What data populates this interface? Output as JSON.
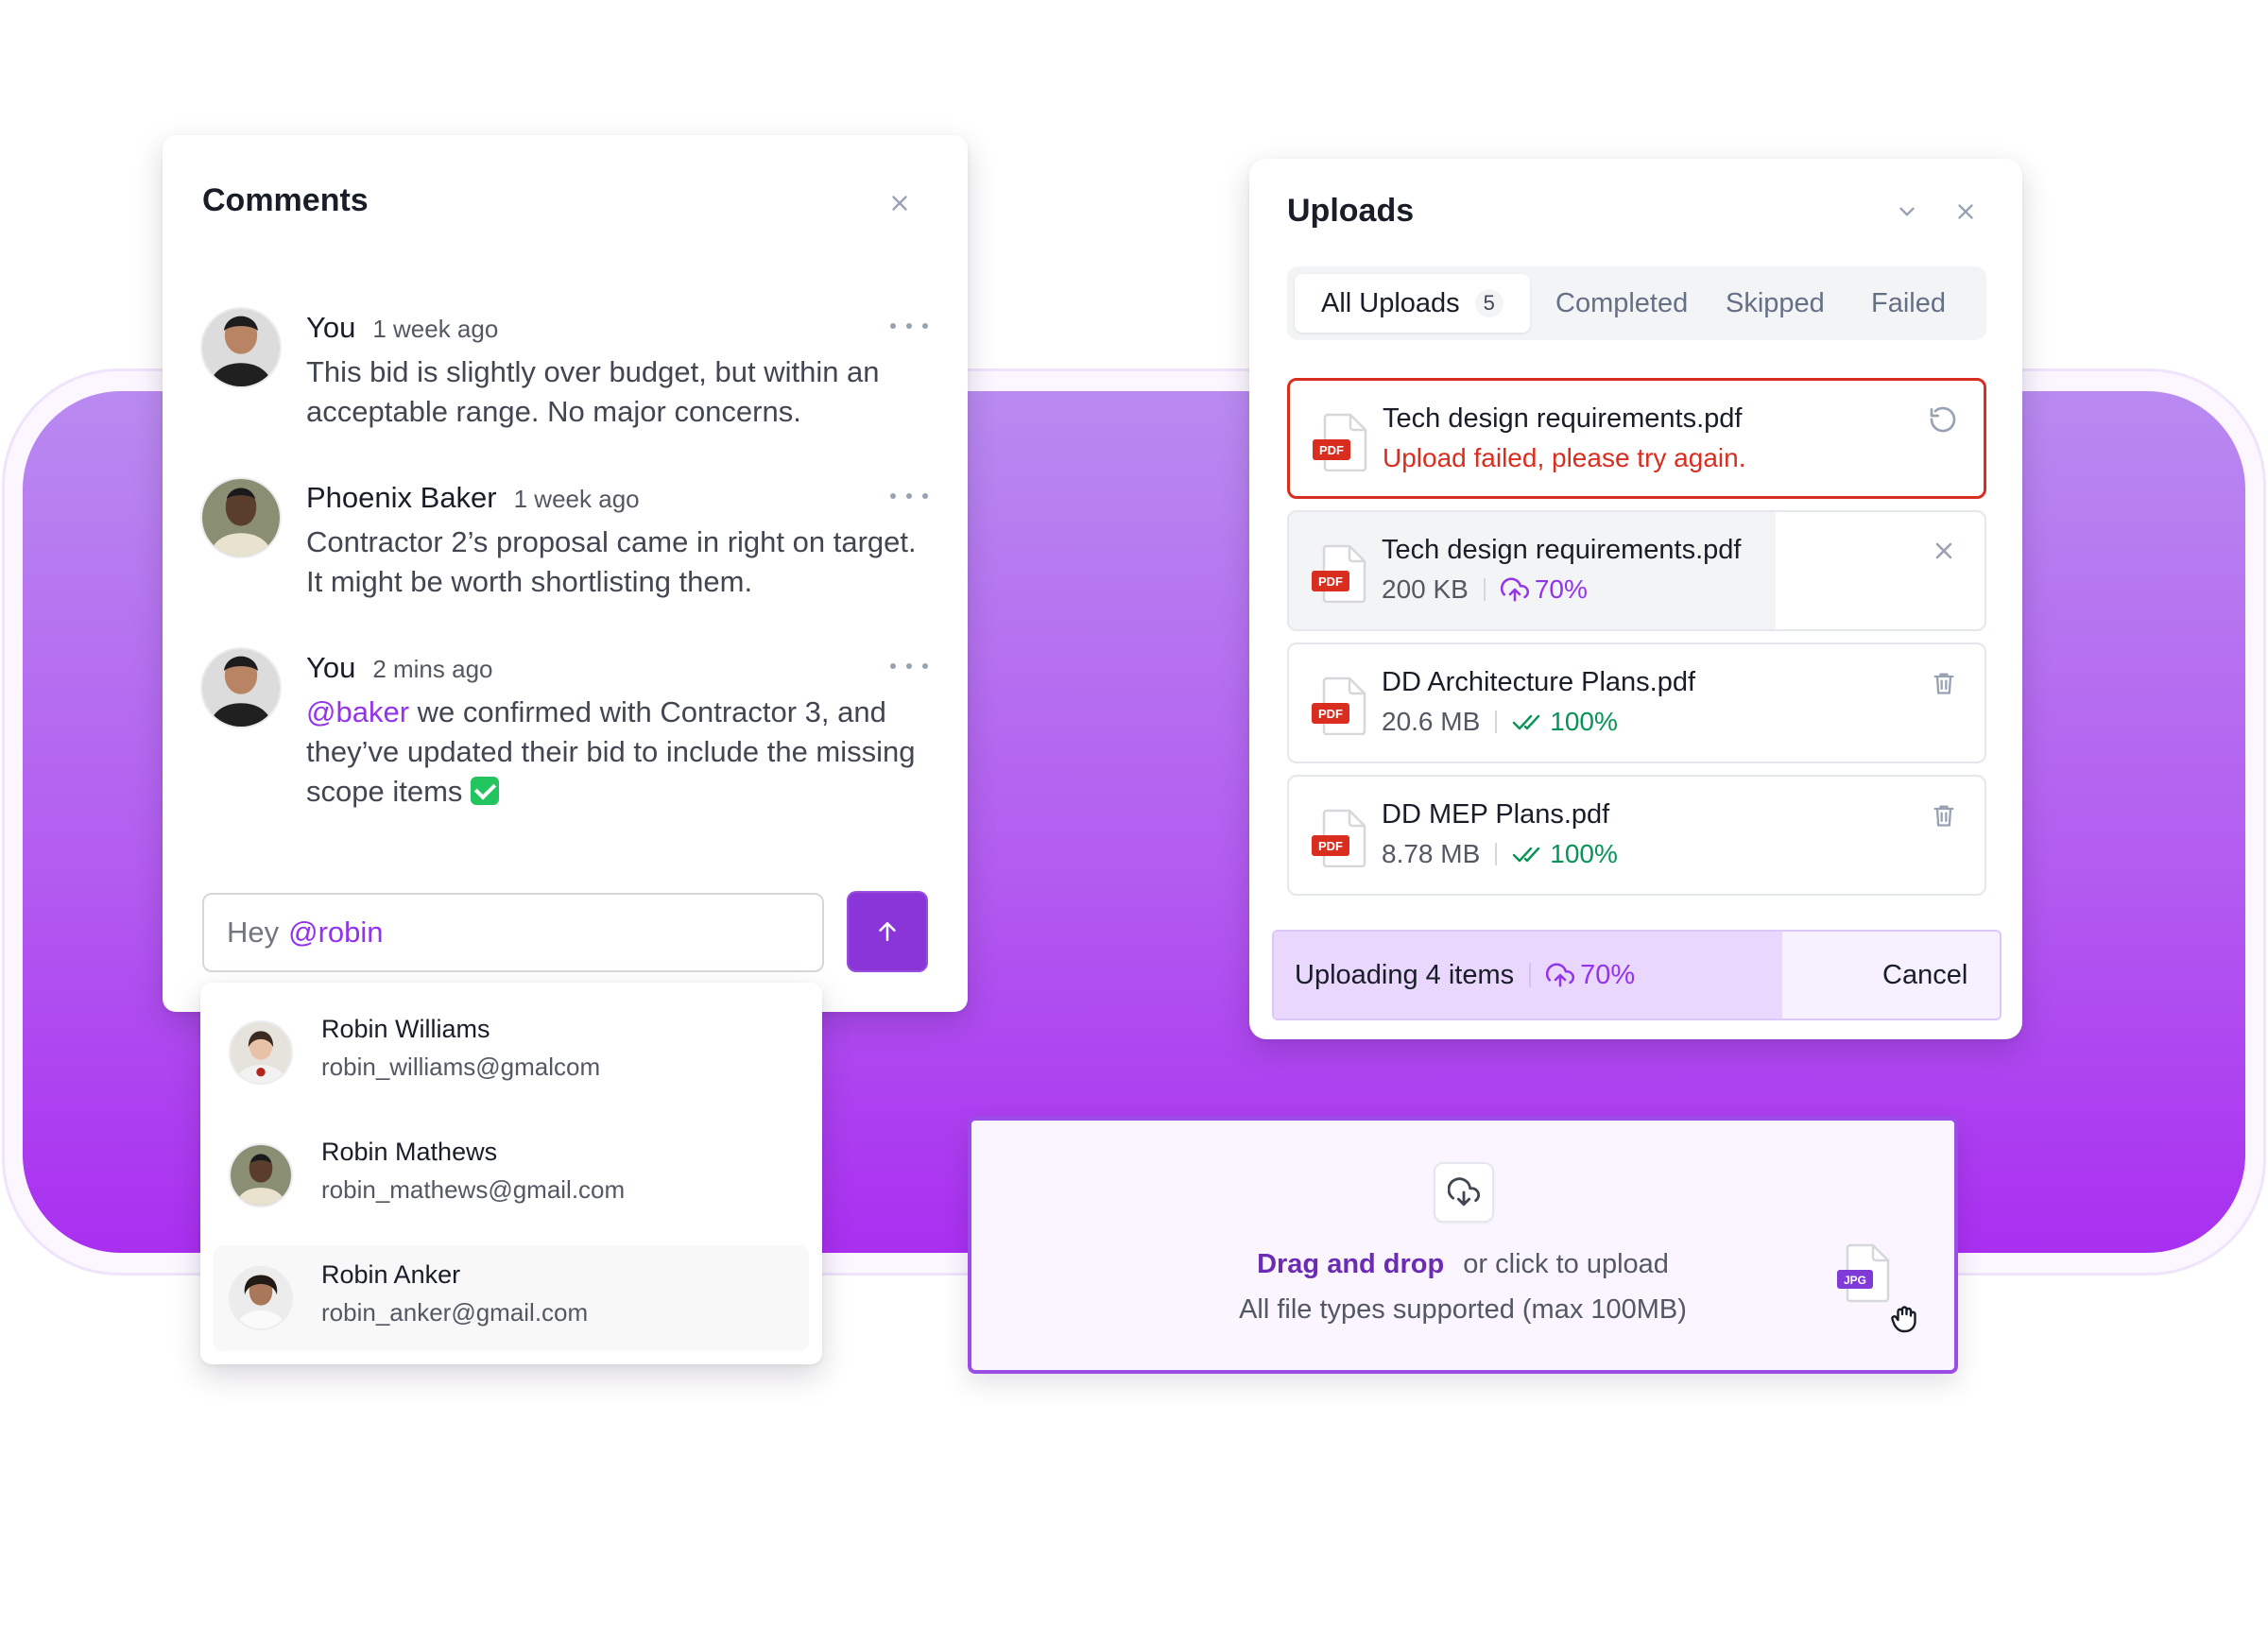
{
  "comments": {
    "title": "Comments",
    "items": [
      {
        "name": "You",
        "time": "1 week ago",
        "text": "This bid is slightly over budget, but within an acceptable range. No major concerns."
      },
      {
        "name": "Phoenix Baker",
        "time": "1 week ago",
        "text": "Contractor 2’s proposal came in right on target. It might be worth shortlisting them."
      },
      {
        "name": "You",
        "time": "2 mins ago",
        "mention": "@baker",
        "text": " we confirmed with Contractor 3, and they’ve updated their bid to include the missing scope items "
      }
    ],
    "input": {
      "prefix": "Hey",
      "mention": "@robin"
    }
  },
  "mentions": [
    {
      "name": "Robin Williams",
      "email": "robin_williams@gmalcom"
    },
    {
      "name": "Robin Mathews",
      "email": "robin_mathews@gmail.com"
    },
    {
      "name": "Robin Anker",
      "email": "robin_anker@gmail.com"
    }
  ],
  "uploads": {
    "title": "Uploads",
    "tabs": [
      {
        "label": "All Uploads",
        "count": "5"
      },
      {
        "label": "Completed"
      },
      {
        "label": "Skipped"
      },
      {
        "label": "Failed"
      }
    ],
    "files": [
      {
        "name": "Tech design requirements.pdf",
        "error": "Upload failed, please try again.",
        "icon_label": "PDF"
      },
      {
        "name": "Tech design requirements.pdf",
        "size": "200 KB",
        "percent": "70%",
        "progress": 0.7,
        "icon_label": "PDF"
      },
      {
        "name": "DD Architecture Plans.pdf",
        "size": "20.6 MB",
        "percent": "100%",
        "icon_label": "PDF"
      },
      {
        "name": "DD MEP Plans.pdf",
        "size": "8.78 MB",
        "percent": "100%",
        "icon_label": "PDF"
      }
    ],
    "footer": {
      "label": "Uploading 4 items",
      "percent": "70%",
      "progress": 0.7,
      "cancel": "Cancel"
    }
  },
  "dropzone": {
    "link": "Drag and drop",
    "text": "or click to upload",
    "hint": "All file types supported (max 100MB)",
    "file_badge": "JPG"
  },
  "colors": {
    "accent": "#8a35d8",
    "error": "#d92d20",
    "success": "#079455",
    "band_top": "#b98af0",
    "band_bottom": "#a92ff0"
  }
}
